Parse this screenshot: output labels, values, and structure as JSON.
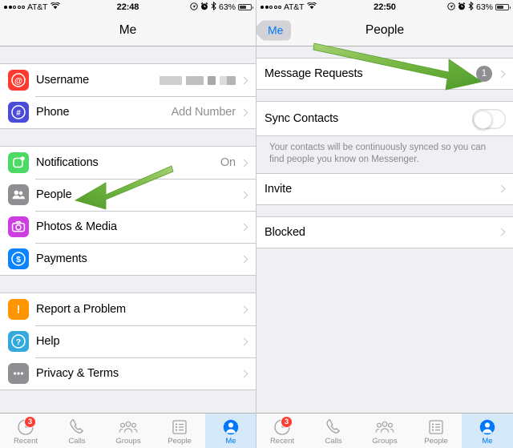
{
  "left": {
    "statusbar": {
      "carrier": "AT&T",
      "time": "22:48",
      "battery_pct": "63%",
      "signal_filled": 2,
      "signal_total": 5,
      "icons": [
        "location-icon",
        "alarm-icon",
        "bluetooth-icon"
      ]
    },
    "nav": {
      "title": "Me"
    },
    "groups": [
      {
        "rows": [
          {
            "icon": "at-sign-icon",
            "icon_color": "#ff3b30",
            "label": "Username",
            "value": "",
            "redacted": true,
            "chevron": true
          },
          {
            "icon": "hash-icon",
            "icon_color": "#4b4bd8",
            "label": "Phone",
            "value": "Add Number",
            "redacted": false,
            "chevron": true
          }
        ]
      },
      {
        "rows": [
          {
            "icon": "notifications-icon",
            "icon_color": "#4cd964",
            "label": "Notifications",
            "value": "On",
            "chevron": true
          },
          {
            "icon": "people-icon",
            "icon_color": "#8e8e93",
            "label": "People",
            "value": "",
            "chevron": true
          },
          {
            "icon": "camera-icon",
            "icon_color": "#cc3ee0",
            "label": "Photos & Media",
            "value": "",
            "chevron": true
          },
          {
            "icon": "dollar-icon",
            "icon_color": "#0b84fe",
            "label": "Payments",
            "value": "",
            "chevron": true
          }
        ]
      },
      {
        "rows": [
          {
            "icon": "exclamation-icon",
            "icon_color": "#ff9500",
            "label": "Report a Problem",
            "value": "",
            "chevron": true
          },
          {
            "icon": "question-icon",
            "icon_color": "#34aadc",
            "label": "Help",
            "value": "",
            "chevron": true
          },
          {
            "icon": "ellipsis-icon",
            "icon_color": "#8e8e93",
            "label": "Privacy & Terms",
            "value": "",
            "chevron": true
          }
        ]
      }
    ],
    "annotation": {
      "type": "arrow",
      "color": "#5aa832",
      "points_to": "People"
    }
  },
  "right": {
    "statusbar": {
      "carrier": "AT&T",
      "time": "22:50",
      "battery_pct": "63%",
      "signal_filled": 2,
      "signal_total": 5,
      "icons": [
        "location-icon",
        "alarm-icon",
        "bluetooth-icon"
      ]
    },
    "nav": {
      "title": "People",
      "back_label": "Me"
    },
    "rows": {
      "message_requests": {
        "label": "Message Requests",
        "badge": "1",
        "chevron": true
      },
      "sync_contacts": {
        "label": "Sync Contacts",
        "toggle_on": false
      },
      "sync_note": "Your contacts will be continuously synced so you can find people you know on Messenger.",
      "invite": {
        "label": "Invite",
        "chevron": true
      },
      "blocked": {
        "label": "Blocked",
        "chevron": true
      }
    },
    "annotation": {
      "type": "arrow",
      "color": "#5aa832",
      "points_to": "Message Requests badge"
    }
  },
  "tabbar": {
    "tabs": [
      {
        "label": "Recent",
        "icon": "clock-icon",
        "badge": "3",
        "active": false
      },
      {
        "label": "Calls",
        "icon": "phone-icon",
        "badge": "",
        "active": false
      },
      {
        "label": "Groups",
        "icon": "groups-icon",
        "badge": "",
        "active": false
      },
      {
        "label": "People",
        "icon": "list-icon",
        "badge": "",
        "active": false
      },
      {
        "label": "Me",
        "icon": "person-icon",
        "badge": "",
        "active": true
      }
    ]
  },
  "colors": {
    "accent": "#0076ff",
    "badge_red": "#ff3b30",
    "arrow_green": "#5aa832",
    "tab_active_bg": "#d6e9fb"
  }
}
